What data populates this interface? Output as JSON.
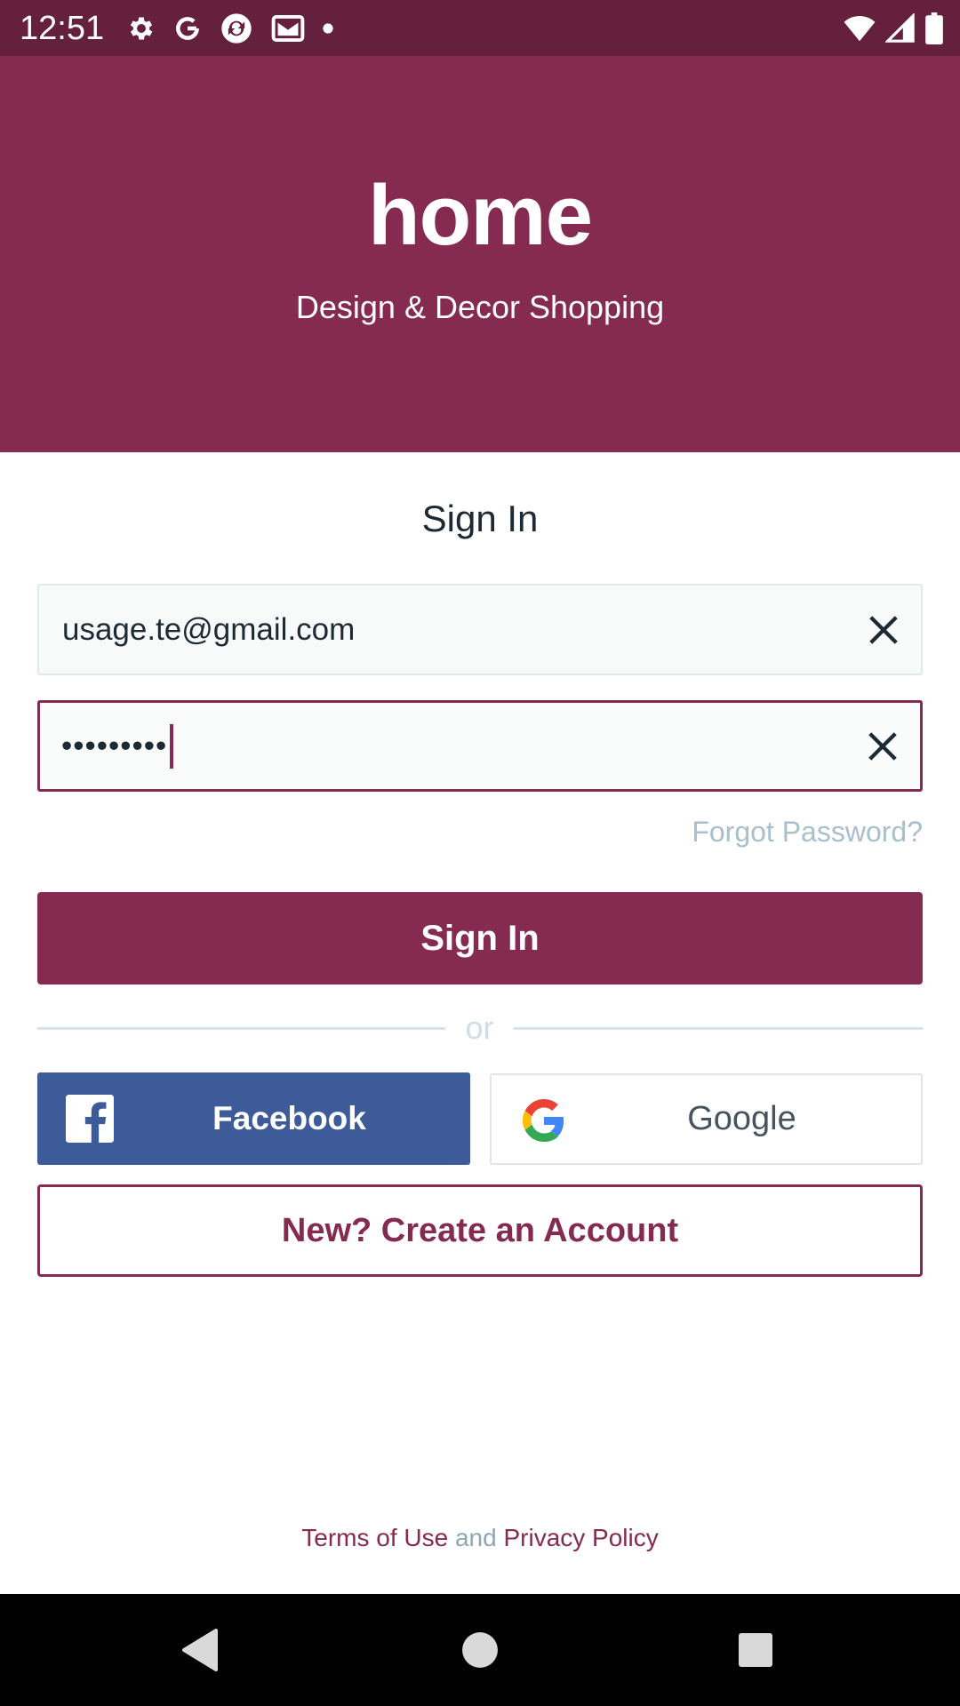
{
  "status_bar": {
    "time": "12:51",
    "left_icons": [
      "gear-icon",
      "google-icon",
      "sync-app-icon",
      "gallery-mail-icon",
      "dot-icon"
    ],
    "right_icons": [
      "wifi-icon",
      "signal-icon",
      "battery-icon"
    ]
  },
  "header": {
    "logo_text": "home",
    "tagline": "Design & Decor Shopping",
    "background_color": "#852b51"
  },
  "form": {
    "title": "Sign In",
    "email_value": "usage.te@gmail.com",
    "password_value": "•••••••••",
    "forgot_password": "Forgot Password?",
    "signin_button": "Sign In",
    "or_text": "or",
    "facebook_button": "Facebook",
    "google_button": "Google",
    "create_account_button": "New? Create an Account"
  },
  "footer": {
    "terms": "Terms of Use",
    "and": "and",
    "privacy": "Privacy Policy"
  },
  "nav_bar": {
    "icons": [
      "back-icon",
      "home-icon",
      "recents-icon"
    ]
  },
  "colors": {
    "brand": "#852b51",
    "status_bar": "#65203e",
    "facebook": "#3d5b99"
  }
}
